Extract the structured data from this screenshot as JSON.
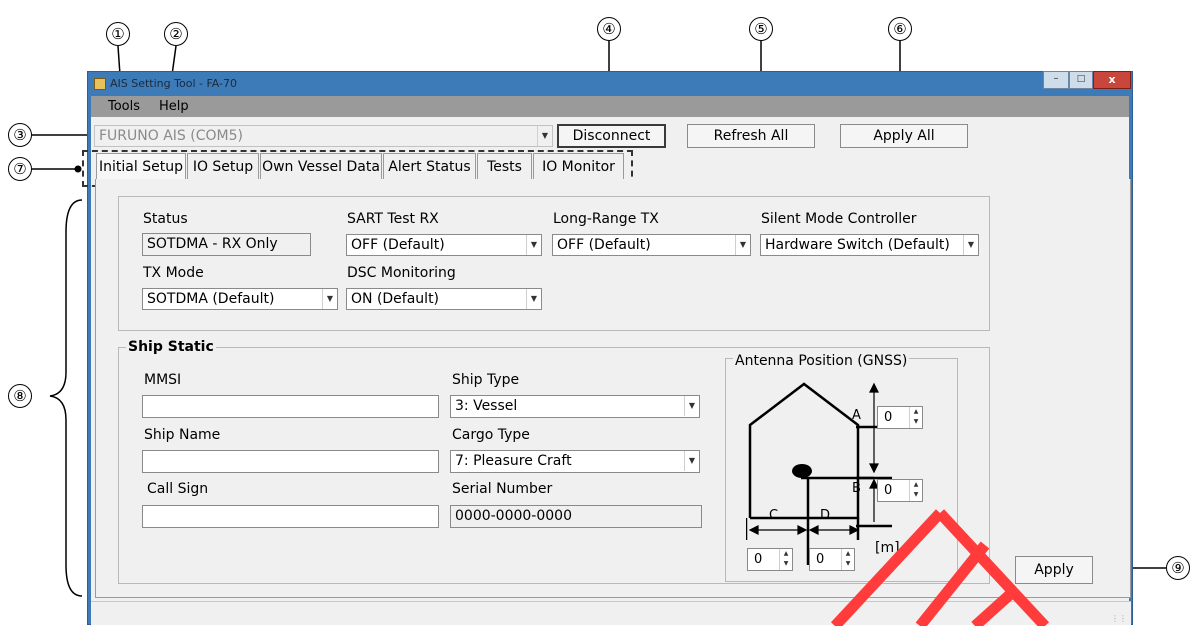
{
  "callouts": [
    "①",
    "②",
    "③",
    "④",
    "⑤",
    "⑥",
    "⑦",
    "⑧",
    "⑨"
  ],
  "window": {
    "title": "AIS Setting Tool - FA-70"
  },
  "menu": {
    "tools": "Tools",
    "help": "Help"
  },
  "toolbar": {
    "port_value": "FURUNO AIS (COM5)",
    "disconnect": "Disconnect",
    "refresh_all": "Refresh All",
    "apply_all": "Apply All"
  },
  "tabs": [
    "Initial Setup",
    "IO Setup",
    "Own Vessel Data",
    "Alert Status",
    "Tests",
    "IO Monitor"
  ],
  "settings": {
    "status_label": "Status",
    "status_value": "SOTDMA - RX Only",
    "sart_label": "SART Test RX",
    "sart_value": "OFF (Default)",
    "longrange_label": "Long-Range TX",
    "longrange_value": "OFF (Default)",
    "silent_label": "Silent Mode Controller",
    "silent_value": "Hardware Switch (Default)",
    "txmode_label": "TX Mode",
    "txmode_value": "SOTDMA (Default)",
    "dsc_label": "DSC Monitoring",
    "dsc_value": "ON (Default)"
  },
  "ship_static": {
    "title": "Ship Static",
    "mmsi_label": "MMSI",
    "mmsi_value": "",
    "name_label": "Ship Name",
    "name_value": "",
    "callsign_label": "Call Sign",
    "callsign_value": "",
    "shiptype_label": "Ship Type",
    "shiptype_value": "3: Vessel",
    "cargo_label": "Cargo Type",
    "cargo_value": "7: Pleasure Craft",
    "serial_label": "Serial Number",
    "serial_value": "0000-0000-0000"
  },
  "antenna": {
    "title": "Antenna Position (GNSS)",
    "a_label": "A",
    "b_label": "B",
    "c_label": "C",
    "d_label": "D",
    "a_value": "0",
    "b_value": "0",
    "c_value": "0",
    "d_value": "0",
    "unit": "[m]"
  },
  "apply": "Apply"
}
